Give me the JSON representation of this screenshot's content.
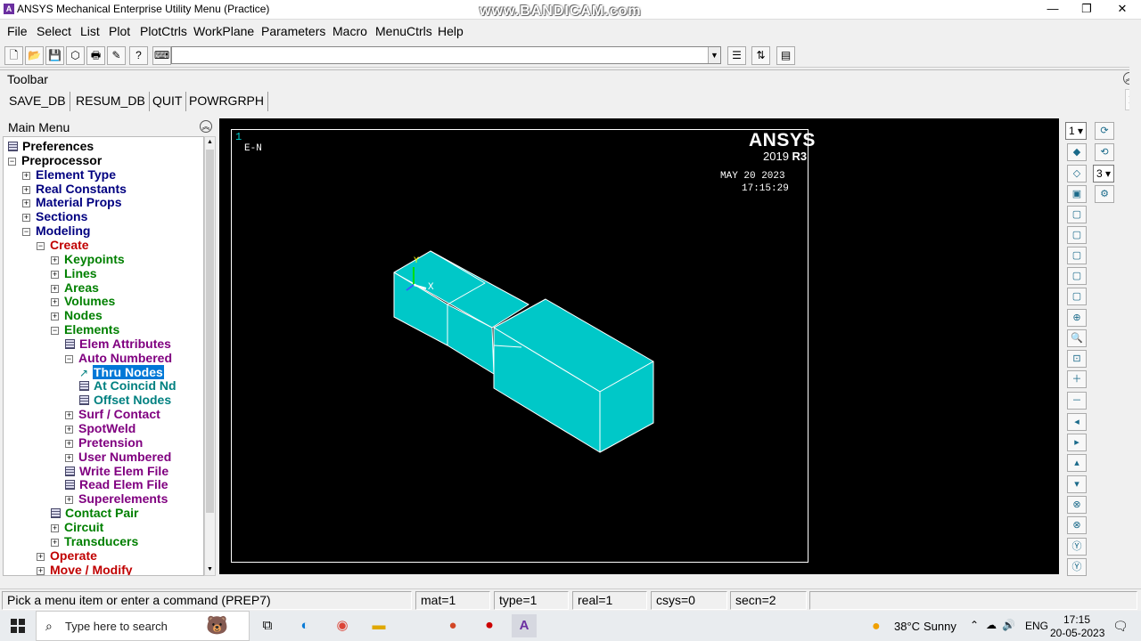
{
  "window": {
    "title": "ANSYS Mechanical Enterprise Utility Menu (Practice)",
    "watermark": "www.BANDICAM.com",
    "app_icon_letter": "A",
    "minimize": "—",
    "maximize": "❐",
    "close": "✕"
  },
  "menubar": {
    "items": [
      "File",
      "Select",
      "List",
      "Plot",
      "PlotCtrls",
      "WorkPlane",
      "Parameters",
      "Macro",
      "MenuCtrls",
      "Help"
    ]
  },
  "command": {
    "value": "",
    "placeholder": ""
  },
  "toolbar": {
    "label": "Toolbar",
    "buttons": [
      "SAVE_DB",
      "RESUM_DB",
      "QUIT",
      "POWRGRPH"
    ]
  },
  "main_menu": {
    "label": "Main Menu",
    "items": [
      {
        "label": "Preferences",
        "indent": 0,
        "marker": "doc",
        "color": "black"
      },
      {
        "label": "Preprocessor",
        "indent": 0,
        "marker": "minus",
        "color": "black"
      },
      {
        "label": "Element Type",
        "indent": 1,
        "marker": "plus",
        "color": "navy"
      },
      {
        "label": "Real Constants",
        "indent": 1,
        "marker": "plus",
        "color": "navy"
      },
      {
        "label": "Material Props",
        "indent": 1,
        "marker": "plus",
        "color": "navy"
      },
      {
        "label": "Sections",
        "indent": 1,
        "marker": "plus",
        "color": "navy"
      },
      {
        "label": "Modeling",
        "indent": 1,
        "marker": "minus",
        "color": "navy"
      },
      {
        "label": "Create",
        "indent": 2,
        "marker": "minus",
        "color": "red"
      },
      {
        "label": "Keypoints",
        "indent": 3,
        "marker": "plus",
        "color": "green"
      },
      {
        "label": "Lines",
        "indent": 3,
        "marker": "plus",
        "color": "green"
      },
      {
        "label": "Areas",
        "indent": 3,
        "marker": "plus",
        "color": "green"
      },
      {
        "label": "Volumes",
        "indent": 3,
        "marker": "plus",
        "color": "green"
      },
      {
        "label": "Nodes",
        "indent": 3,
        "marker": "plus",
        "color": "green"
      },
      {
        "label": "Elements",
        "indent": 3,
        "marker": "minus",
        "color": "green"
      },
      {
        "label": "Elem Attributes",
        "indent": 4,
        "marker": "doc",
        "color": "purple"
      },
      {
        "label": "Auto Numbered",
        "indent": 4,
        "marker": "minus",
        "color": "purple"
      },
      {
        "label": "Thru Nodes",
        "indent": 5,
        "marker": "arrow",
        "color": "teal",
        "selected": true
      },
      {
        "label": "At Coincid Nd",
        "indent": 5,
        "marker": "doc",
        "color": "teal"
      },
      {
        "label": "Offset Nodes",
        "indent": 5,
        "marker": "doc",
        "color": "teal"
      },
      {
        "label": "Surf / Contact",
        "indent": 4,
        "marker": "plus",
        "color": "purple"
      },
      {
        "label": "SpotWeld",
        "indent": 4,
        "marker": "plus",
        "color": "purple"
      },
      {
        "label": "Pretension",
        "indent": 4,
        "marker": "plus",
        "color": "purple"
      },
      {
        "label": "User Numbered",
        "indent": 4,
        "marker": "plus",
        "color": "purple"
      },
      {
        "label": "Write Elem File",
        "indent": 4,
        "marker": "doc",
        "color": "purple"
      },
      {
        "label": "Read Elem File",
        "indent": 4,
        "marker": "doc",
        "color": "purple"
      },
      {
        "label": "Superelements",
        "indent": 4,
        "marker": "plus",
        "color": "purple"
      },
      {
        "label": "Contact Pair",
        "indent": 3,
        "marker": "doc",
        "color": "green"
      },
      {
        "label": "Circuit",
        "indent": 3,
        "marker": "plus",
        "color": "green"
      },
      {
        "label": "Transducers",
        "indent": 3,
        "marker": "plus",
        "color": "green"
      },
      {
        "label": "Operate",
        "indent": 2,
        "marker": "plus",
        "color": "red"
      },
      {
        "label": "Move / Modify",
        "indent": 2,
        "marker": "plus",
        "color": "red"
      }
    ]
  },
  "graphics": {
    "window_number": "1",
    "plot_label": "E-N",
    "brand": "ANSYS",
    "version_year": "2019",
    "version_release": "R3",
    "date": "MAY 20 2023",
    "time": "17:15:29",
    "triad_y": "Y",
    "triad_x": "X",
    "model_color": "#00c8c8"
  },
  "view_controls": {
    "window_select": "1",
    "views_select": "3"
  },
  "status": {
    "prompt": "Pick a menu item or enter a command (PREP7)",
    "mat": "mat=1",
    "type": "type=1",
    "real": "real=1",
    "csys": "csys=0",
    "secn": "secn=2"
  },
  "taskbar": {
    "search_placeholder": "Type here to search",
    "weather_temp": "38°C",
    "weather_desc": "Sunny",
    "language": "ENG",
    "clock_time": "17:15",
    "clock_date": "20-05-2023"
  },
  "colors": {
    "selection": "#0078d7",
    "graphics_bg": "#000000",
    "tree_navy": "#000080",
    "tree_red": "#c00000",
    "tree_green": "#008000",
    "tree_purple": "#800080",
    "tree_teal": "#008080"
  }
}
